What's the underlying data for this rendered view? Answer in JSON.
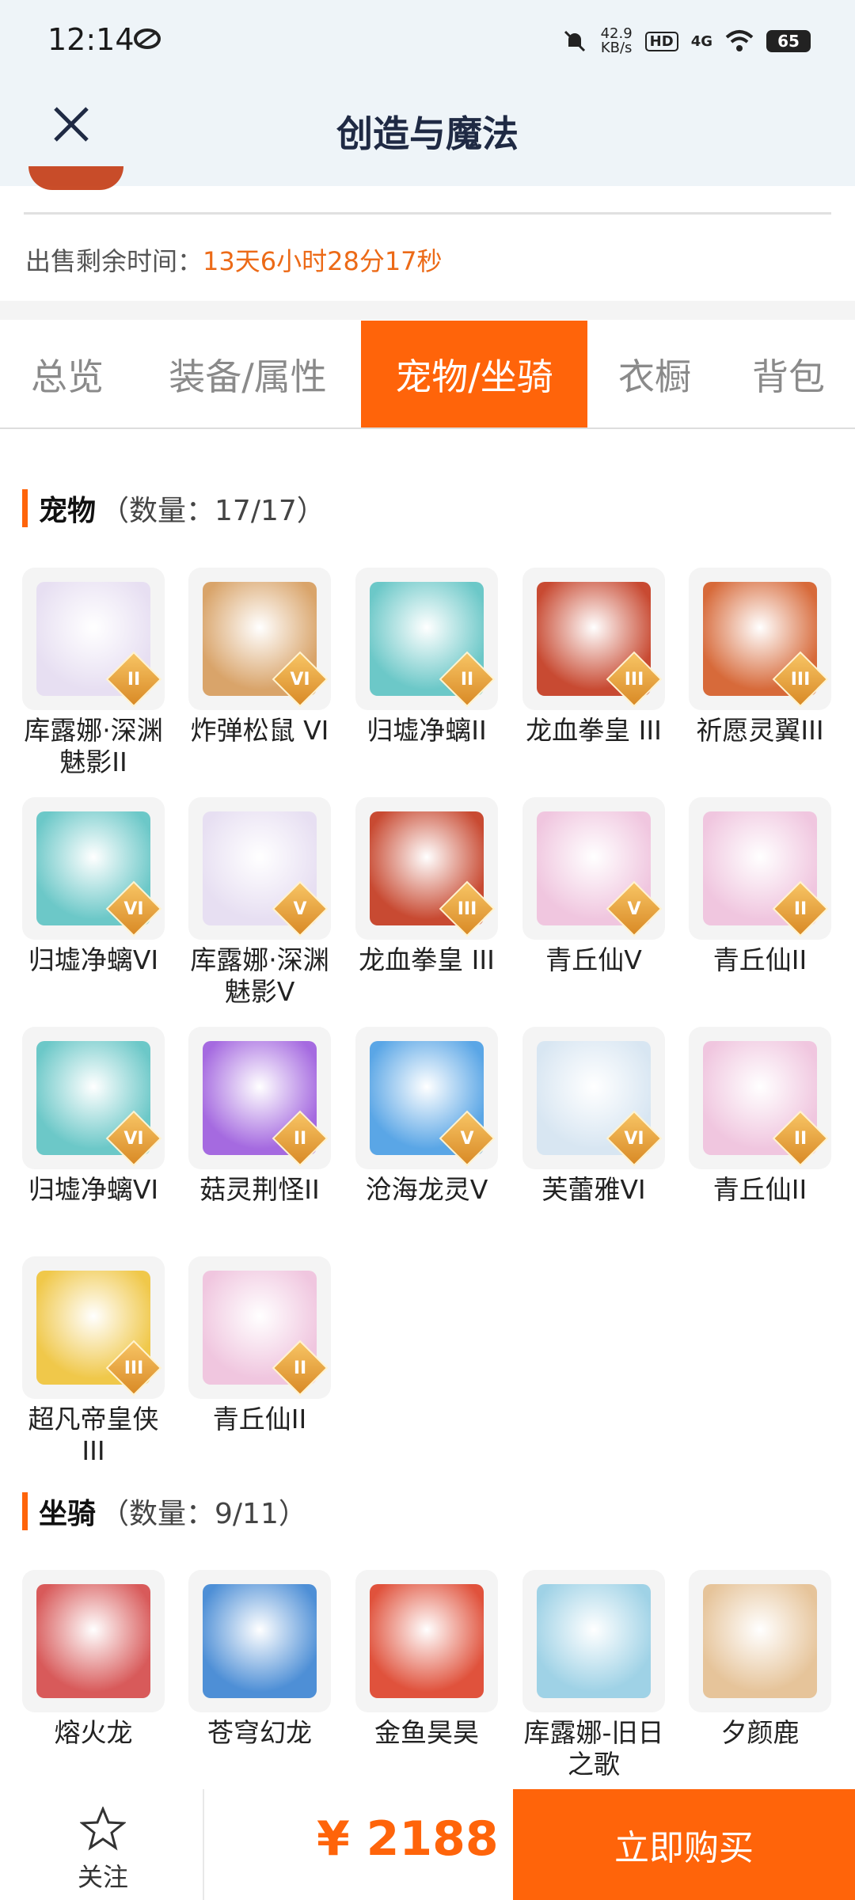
{
  "status": {
    "time": "12:14",
    "net_speed_top": "42.9",
    "net_speed_unit": "KB/s",
    "hd": "HD",
    "network": "4G",
    "battery": "65"
  },
  "header": {
    "title": "创造与魔法"
  },
  "sale": {
    "label": "出售剩余时间：",
    "value": "13天6小时28分17秒"
  },
  "tabs": [
    {
      "label": "总览"
    },
    {
      "label": "装备/属性"
    },
    {
      "label": "宠物/坐骑"
    },
    {
      "label": "衣橱"
    },
    {
      "label": "背包"
    }
  ],
  "pets": {
    "title": "宠物",
    "count": "（数量：17/17）",
    "items": [
      {
        "name": "库露娜·深渊魅影II",
        "tier": "II",
        "color": "#e7dff2"
      },
      {
        "name": "炸弹松鼠 VI",
        "tier": "VI",
        "color": "#d9a46a"
      },
      {
        "name": "归墟净螭II",
        "tier": "II",
        "color": "#6cc8c8"
      },
      {
        "name": "龙血拳皇 III",
        "tier": "III",
        "color": "#c84a32"
      },
      {
        "name": "祈愿灵翼III",
        "tier": "III",
        "color": "#d76a3a"
      },
      {
        "name": "归墟净螭VI",
        "tier": "VI",
        "color": "#6cc8c8"
      },
      {
        "name": "库露娜·深渊魅影V",
        "tier": "V",
        "color": "#e7dff2"
      },
      {
        "name": "龙血拳皇 III",
        "tier": "III",
        "color": "#c84a32"
      },
      {
        "name": "青丘仙V",
        "tier": "V",
        "color": "#f0c6df"
      },
      {
        "name": "青丘仙II",
        "tier": "II",
        "color": "#f0c6df"
      },
      {
        "name": "归墟净螭VI",
        "tier": "VI",
        "color": "#6cc8c8"
      },
      {
        "name": "菇灵荆怪II",
        "tier": "II",
        "color": "#a56ae0"
      },
      {
        "name": "沧海龙灵V",
        "tier": "V",
        "color": "#5aa6e6"
      },
      {
        "name": "芙蕾雅VI",
        "tier": "VI",
        "color": "#d8e6f2"
      },
      {
        "name": "青丘仙II",
        "tier": "II",
        "color": "#f0c6df"
      },
      {
        "name": "超凡帝皇侠III",
        "tier": "III",
        "color": "#f0c84a"
      },
      {
        "name": "青丘仙II",
        "tier": "II",
        "color": "#f0c6df"
      }
    ]
  },
  "mounts": {
    "title": "坐骑",
    "count": "（数量：9/11）",
    "items": [
      {
        "name": "熔火龙",
        "color": "#d85a5a"
      },
      {
        "name": "苍穹幻龙",
        "color": "#4e8fd6"
      },
      {
        "name": "金鱼昊昊",
        "color": "#e0523c"
      },
      {
        "name": "库露娜-旧日之歌",
        "color": "#9fd2e6"
      },
      {
        "name": "夕颜鹿",
        "color": "#e6c49a"
      }
    ]
  },
  "bottom": {
    "follow_label": "关注",
    "price": "¥ 2188",
    "buy_label": "立即购买"
  }
}
